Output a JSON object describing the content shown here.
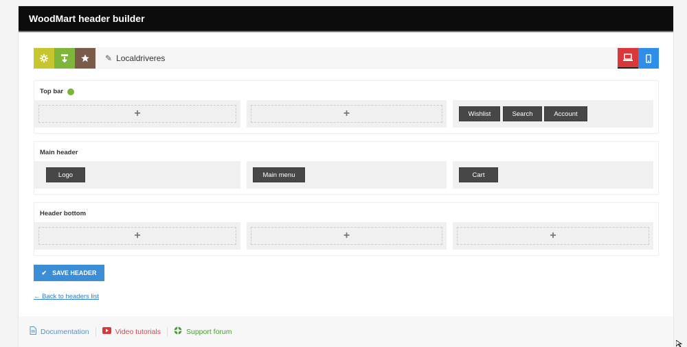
{
  "window": {
    "title": "WoodMart header builder"
  },
  "toolbar": {
    "header_name": "Localdriveres",
    "icons": [
      "gear-icon",
      "import-icon",
      "star-icon",
      "pencil-icon",
      "desktop-icon",
      "mobile-icon"
    ],
    "colors": {
      "settings": "#c8c62f",
      "import": "#80b53c",
      "star": "#7a5a48",
      "desktop": "#d9383a",
      "mobile": "#2f8fe8"
    }
  },
  "rows": {
    "top_bar": {
      "title": "Top bar",
      "col1_add": "+",
      "col2_add": "+",
      "col3": [
        "Wishlist",
        "Search",
        "Account"
      ]
    },
    "main_header": {
      "title": "Main header",
      "col1": [
        "Logo"
      ],
      "col2": [
        "Main menu"
      ],
      "col3": [
        "Cart"
      ]
    },
    "header_bottom": {
      "title": "Header bottom",
      "col1_add": "+",
      "col2_add": "+",
      "col3_add": "+"
    }
  },
  "actions": {
    "save_label": "SAVE HEADER",
    "back_link": "← Back to headers list"
  },
  "footer": {
    "documentation": "Documentation",
    "video": "Video tutorials",
    "support": "Support forum"
  }
}
